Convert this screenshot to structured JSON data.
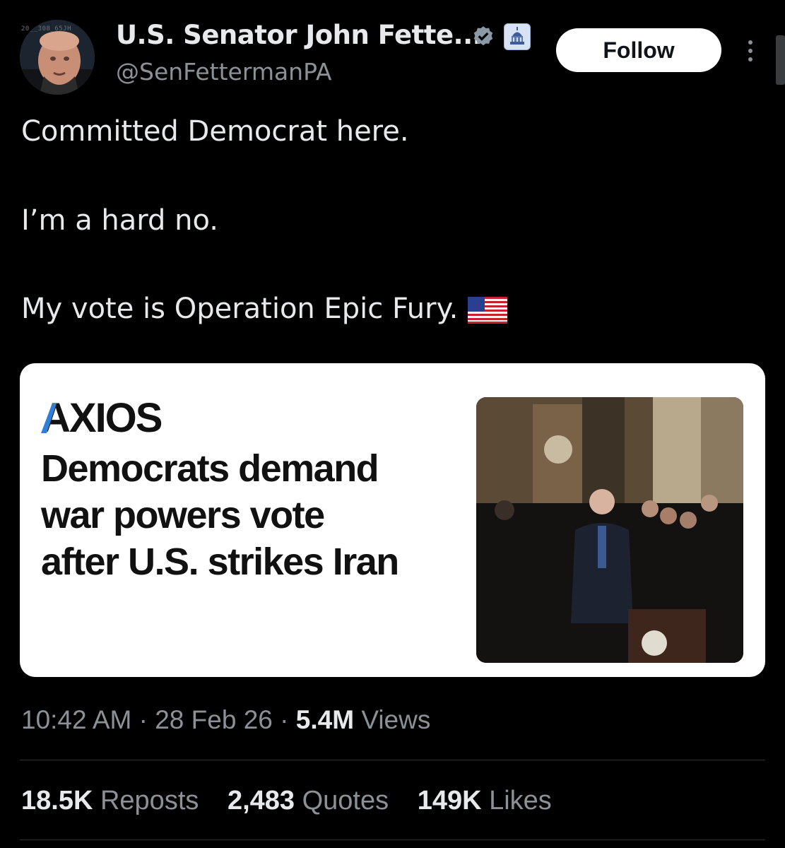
{
  "author": {
    "name": "U.S. Senator John Fette...",
    "handle": "@SenFettermanPA",
    "avatar_tag": "20__308_65JH"
  },
  "follow_label": "Follow",
  "tweet": {
    "lines": [
      "Committed Democrat here.",
      "I’m a hard no.",
      "My vote is Operation Epic Fury."
    ]
  },
  "card": {
    "source": "AXIOS",
    "headline": [
      "Democrats demand",
      "war powers vote",
      "after U.S. strikes Iran"
    ]
  },
  "meta": {
    "time": "10:42 AM",
    "date": "28 Feb 26",
    "views_count": "5.4M",
    "views_label": "Views",
    "separator": "·"
  },
  "stats": {
    "reposts_count": "18.5K",
    "reposts_label": "Reposts",
    "quotes_count": "2,483",
    "quotes_label": "Quotes",
    "likes_count": "149K",
    "likes_label": "Likes"
  },
  "icons": {
    "verified": "verified-badge-icon",
    "affiliation": "capitol-badge-icon",
    "more": "more-vertical-icon",
    "flag": "us-flag-icon"
  },
  "colors": {
    "background": "#000000",
    "text_primary": "#e7e9ea",
    "text_secondary": "#8b9197",
    "follow_bg": "#ffffff",
    "axios_accent": "#2f7fd8"
  }
}
